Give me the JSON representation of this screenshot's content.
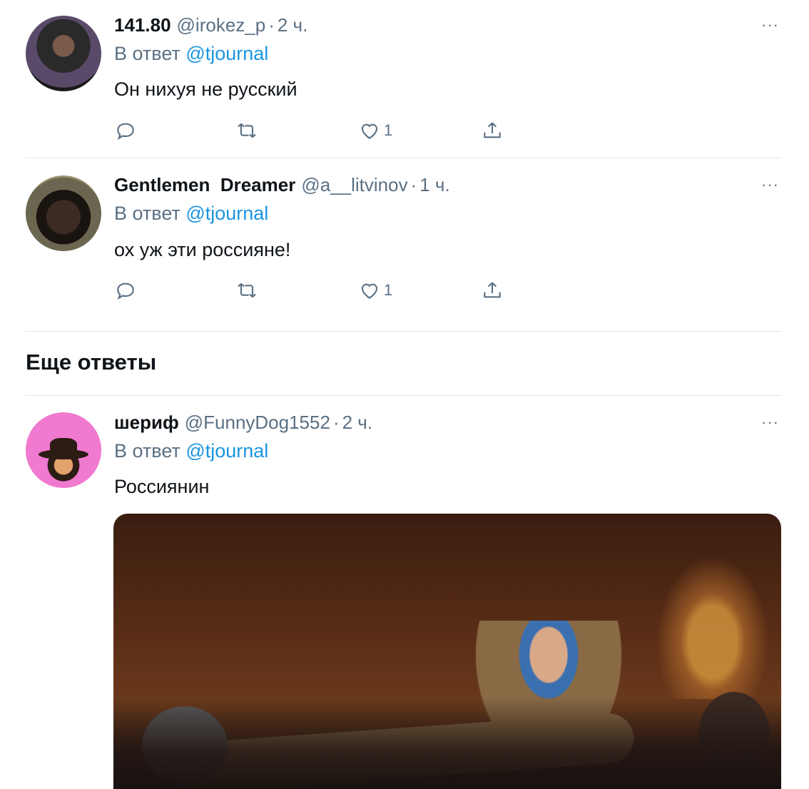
{
  "tweets": [
    {
      "name": "141.80",
      "handle": "@irokez_p",
      "sep": "·",
      "time": "2 ч.",
      "reply_prefix": "В ответ",
      "reply_to": "@tjournal",
      "text": "Он нихуя не русский",
      "likes": "1"
    },
    {
      "name": "Gentlemen  Dreamer",
      "handle": "@a__litvinov",
      "sep": "·",
      "time": "1 ч.",
      "reply_prefix": "В ответ",
      "reply_to": "@tjournal",
      "text": "ох уж эти россияне!",
      "likes": "1"
    },
    {
      "name": "шериф",
      "handle": "@FunnyDog1552",
      "sep": "·",
      "time": "2 ч.",
      "reply_prefix": "В ответ",
      "reply_to": "@tjournal",
      "text": "Россиянин"
    }
  ],
  "section_title": "Еще ответы",
  "more_label": "···",
  "icons": [
    "reply-icon",
    "retweet-icon",
    "like-icon",
    "share-icon",
    "more-icon"
  ],
  "colors": {
    "accent": "#1b95e0",
    "secondary_text": "#5b7083",
    "divider": "#e1e8ed"
  }
}
